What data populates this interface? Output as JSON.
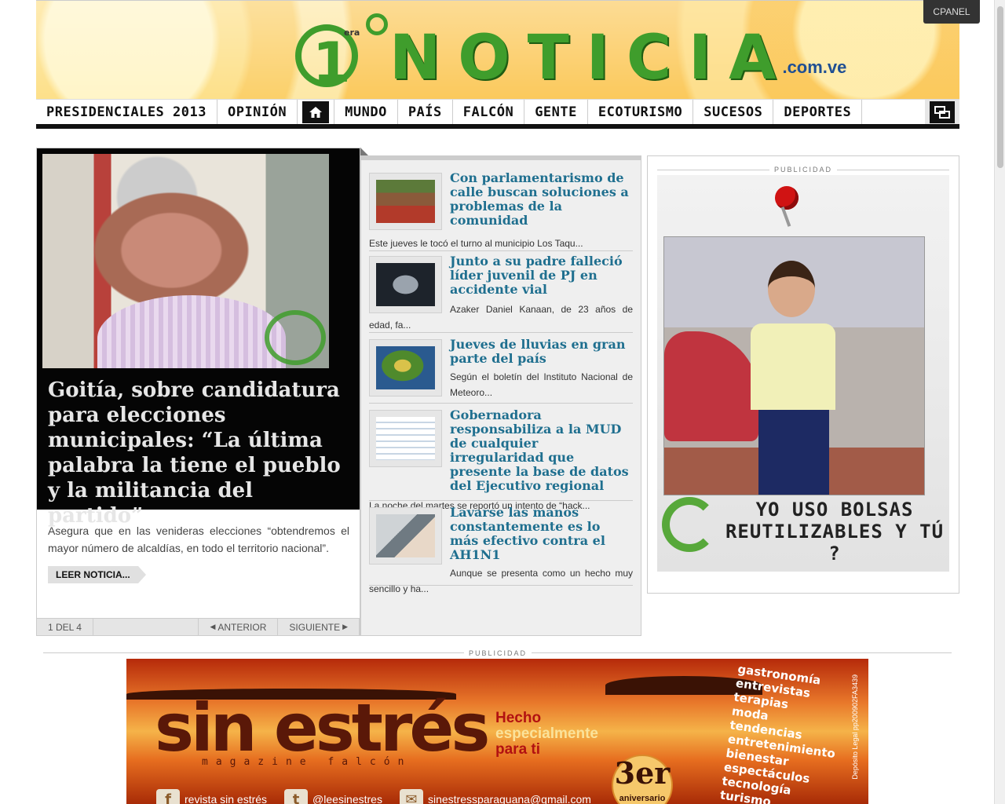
{
  "header": {
    "logo_prefix": "1",
    "logo_era": "era",
    "logo_word": "NOTICIA",
    "logo_domain": ".com.ve",
    "cpanel_label": "CPANEL"
  },
  "nav": {
    "items": [
      "PRESIDENCIALES 2013",
      "OPINIÓN",
      "MUNDO",
      "PAÍS",
      "FALCÓN",
      "GENTE",
      "ECOTURISMO",
      "SUCESOS",
      "DEPORTES"
    ],
    "home_icon": "home-icon",
    "extra_icon": "chat-icon"
  },
  "feature": {
    "title": "Goitía, sobre candidatura para elecciones municipales: “La última palabra la tiene el pueblo y la militancia del partido”",
    "description": "Asegura que en las venideras elecciones “obtendremos el mayor número de alcaldías, en todo el territorio nacional”.",
    "read_more": "LEER NOTICIA...",
    "pager": {
      "position": "1 DEL 4",
      "prev": "ANTERIOR",
      "next": "SIGUIENTE"
    }
  },
  "news": [
    {
      "title": "Con parlamentarismo de calle buscan soluciones a problemas de la comunidad",
      "snippet": "Este jueves le tocó el turno al municipio Los Taqu..."
    },
    {
      "title": "Junto a su padre falleció líder juvenil de PJ en accidente vial",
      "snippet": "Azaker Daniel Kanaan, de 23 años de edad, fa..."
    },
    {
      "title": "Jueves de lluvias en gran parte del país",
      "snippet": "Según el boletín del Instituto Nacional de Meteoro..."
    },
    {
      "title": "Gobernadora responsabiliza a la MUD de cualquier irregularidad que presente la base de datos del Ejecutivo regional",
      "snippet": "La noche del martes se reportó un intento de “hack..."
    },
    {
      "title": "Lavarse las manos constantemente es lo más efectivo contra el AH1N1",
      "snippet": "Aunque se presenta como un hecho muy sencillo y ha..."
    }
  ],
  "ads": {
    "label": "PUBLICIDAD",
    "right_slogan_1": "YO USO BOLSAS",
    "right_slogan_2": "REUTILIZABLES Y TÚ ?",
    "bottom": {
      "brand": "sin estrés",
      "magazine": "magazine falcón",
      "hecho_1": "Hecho",
      "hecho_2": "especialmente",
      "hecho_3": "para ti",
      "aniv_num": "3er",
      "aniv_text": "aniversario",
      "topics": [
        "gastronomía",
        "entrevistas",
        "terapias",
        "moda",
        "tendencias",
        "entretenimiento",
        "bienestar",
        "espectáculos",
        "tecnología",
        "turismo"
      ],
      "legal": "Depósito Legal pp200902FA3439",
      "facebook": "revista sin estrés",
      "twitter": "@leesinestres",
      "email": "sinestressparaguana@gmail.com"
    }
  }
}
